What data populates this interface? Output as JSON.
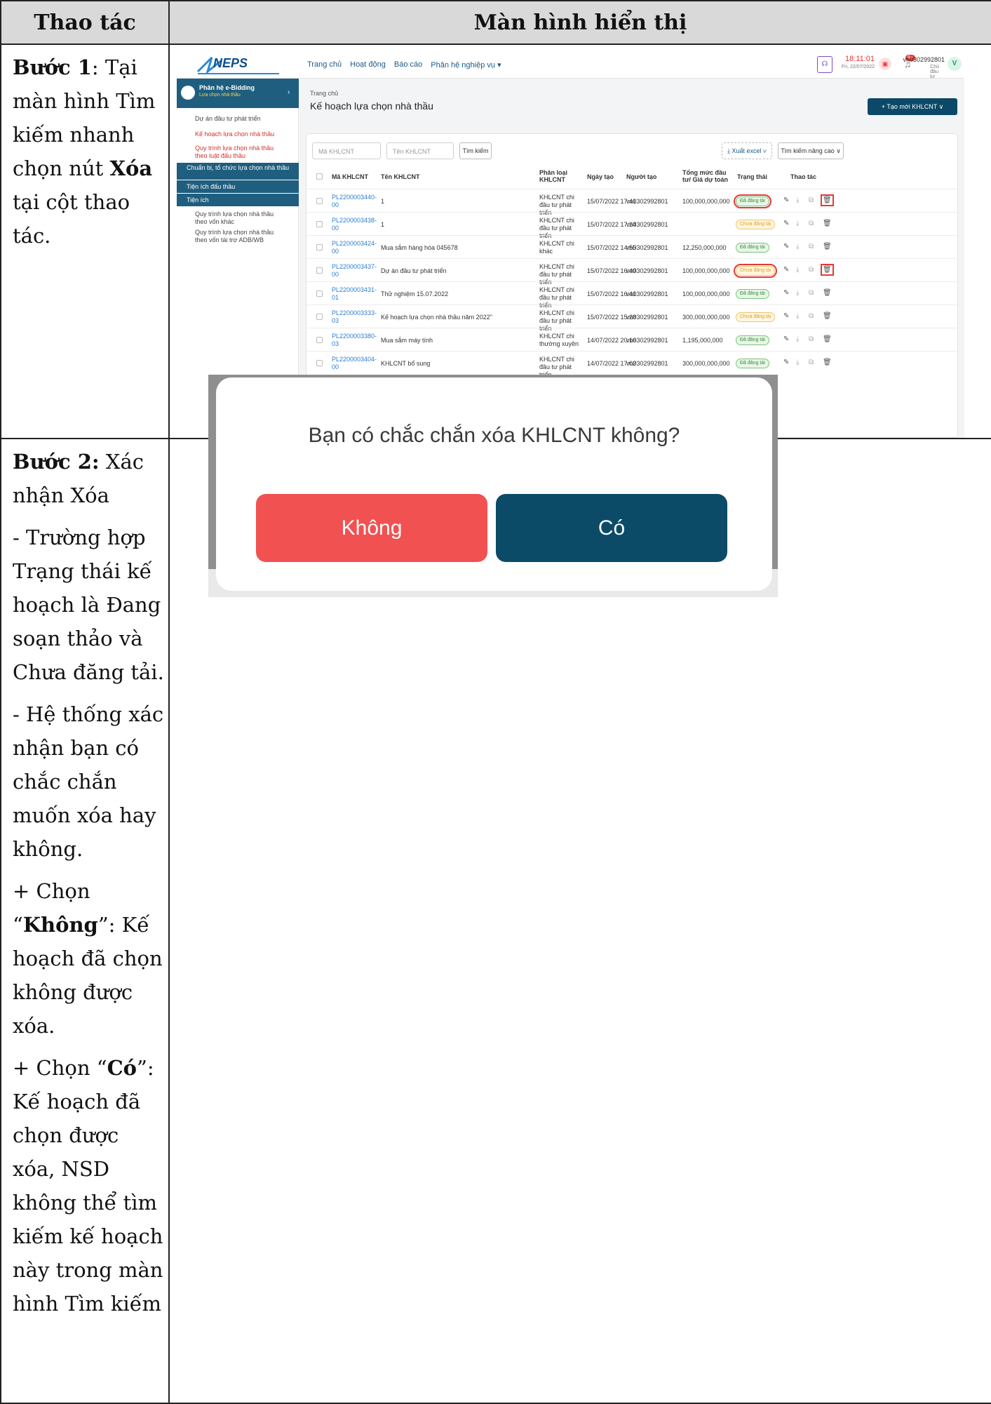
{
  "table": {
    "headers": [
      "Thao tác",
      "Màn hình hiển thị"
    ],
    "step1": {
      "label": "Bước 1",
      "text_a": ": Tại màn hình Tìm kiếm nhanh chọn nút ",
      "bold": "Xóa",
      "text_b": " tại cột thao tác."
    },
    "step2": {
      "label": "Bước 2:",
      "title": " Xác nhận Xóa",
      "p1": "- Trường hợp Trạng thái kế hoạch là Đang soạn thảo và Chưa đăng tải.",
      "p2": "- Hệ thống xác nhận bạn có chắc chắn muốn xóa hay không.",
      "p3_pre": "+ Chọn “",
      "p3_bold": "Không",
      "p3_post": "”: Kế hoạch đã chọn không được xóa.",
      "p4_pre": "+ Chọn “",
      "p4_bold": "Có",
      "p4_post": "”: Kế hoạch đã chọn được xóa, NSD không thể tìm kiếm kế hoạch này trong màn hình Tìm kiếm"
    }
  },
  "app": {
    "logo": "NEPS",
    "nav": [
      "Trang chủ",
      "Hoạt động",
      "Báo cáo",
      "Phân hệ nghiệp vụ ▾"
    ],
    "time": "18:11:01",
    "date": "Fri, 22/07/2022",
    "user": "vn0302992801",
    "role": "Chủ đầu tư",
    "avatar": "V",
    "notif": "9+",
    "sidebar": {
      "module": "Phân hệ e-Bidding",
      "sub": "Lựa chọn nhà thầu",
      "items": [
        "Dự án đầu tư phát triển",
        "Kế hoạch lựa chọn nhà thầu",
        "Quy trình lựa chọn nhà thầu theo luật đấu thầu",
        "Chuẩn bị, tổ chức lựa chọn nhà thầu",
        "Tiện ích đấu thầu",
        "Tiện ích",
        "Quy trình lựa chọn nhà thầu theo vốn khác",
        "Quy trình lựa chọn nhà thầu theo vốn tài trợ ADB/WB"
      ]
    },
    "breadcrumb": "Trang chủ",
    "page_title": "Kế hoạch lựa chọn nhà thầu",
    "new_button": "+ Tạo mới KHLCNT ∨",
    "search": {
      "code_placeholder": "Mã KHLCNT",
      "name_placeholder": "Tên KHLCNT",
      "button": "Tìm kiếm",
      "export": "⤓ Xuất excel ∨",
      "advanced": "Tìm kiếm nâng cao ∨"
    },
    "columns": [
      "Mã KHLCNT",
      "Tên KHLCNT",
      "Phân loại KHLCNT",
      "Ngày tạo",
      "Người tạo",
      "Tổng mức đầu tư/ Giá dự toán",
      "Trạng thái",
      "Thao tác"
    ],
    "rows": [
      {
        "code": "PL2200003440-00",
        "name": "1",
        "type": "KHLCNT chi đầu tư phát triển",
        "date": "15/07/2022 17:41",
        "user": "vn0302992801",
        "amount": "100,000,000,000",
        "status": "Đã đăng tải"
      },
      {
        "code": "PL2200003438-00",
        "name": "1",
        "type": "KHLCNT chi đầu tư phát triển",
        "date": "15/07/2022 17:24",
        "user": "vn0302992801",
        "amount": "",
        "status": "Chưa đăng tải"
      },
      {
        "code": "PL2200003424-00",
        "name": "Mua sắm hàng hóa 045678",
        "type": "KHLCNT chi khác",
        "date": "15/07/2022 14:55",
        "user": "vn0302992801",
        "amount": "12,250,000,000",
        "status": "Đã đăng tải"
      },
      {
        "code": "PL2200003437-00",
        "name": "Dự án đầu tư phát triển",
        "type": "KHLCNT chi đầu tư phát triển",
        "date": "15/07/2022 16:49",
        "user": "vn0302992801",
        "amount": "100,000,000,000",
        "status": "Chưa đăng tải"
      },
      {
        "code": "PL2200003431-01",
        "name": "Thử nghiệm 15.07.2022",
        "type": "KHLCNT chi đầu tư phát triển",
        "date": "15/07/2022 16:41",
        "user": "vn0302992801",
        "amount": "100,000,000,000",
        "status": "Đã đăng tải"
      },
      {
        "code": "PL2200003333-03",
        "name": "Kế hoạch lựa chọn nhà thầu năm 2022''",
        "type": "KHLCNT chi đầu tư phát triển",
        "date": "15/07/2022 15:28",
        "user": "vn0302992801",
        "amount": "300,000,000,000",
        "status": "Chưa đăng tải"
      },
      {
        "code": "PL2200003380-03",
        "name": "Mua sắm máy tính",
        "type": "KHLCNT chi thường xuyên",
        "date": "14/07/2022 20:16",
        "user": "vn0302992801",
        "amount": "1,195,000,000",
        "status": "Đã đăng tải"
      },
      {
        "code": "PL2200003404-00",
        "name": "KHLCNT bổ sung",
        "type": "KHLCNT chi đầu tư phát triển",
        "date": "14/07/2022 17:02",
        "user": "vn0302992801",
        "amount": "300,000,000,000",
        "status": "Đã đăng tải"
      }
    ]
  },
  "dialog": {
    "message": "Bạn có chắc chắn xóa KHLCNT không?",
    "no": "Không",
    "yes": "Có"
  }
}
